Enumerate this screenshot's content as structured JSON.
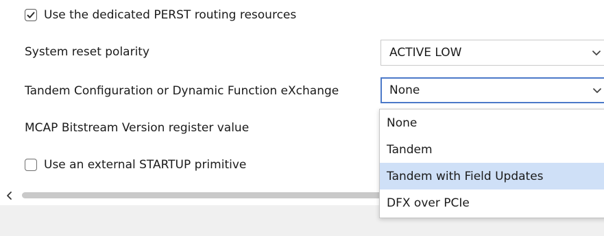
{
  "options": {
    "use_perst_label": "Use the dedicated PERST routing resources",
    "use_perst_checked": true,
    "system_reset_label": "System reset polarity",
    "system_reset_value": "ACTIVE LOW",
    "tandem_label": "Tandem Configuration or Dynamic Function eXchange",
    "tandem_value": "None",
    "mcap_label": "MCAP Bitstream Version register value",
    "startup_label": "Use an external STARTUP primitive",
    "startup_checked": false
  },
  "tandem_dropdown": {
    "items": [
      {
        "label": "None"
      },
      {
        "label": "Tandem"
      },
      {
        "label": "Tandem with Field Updates",
        "highlighted": true
      },
      {
        "label": "DFX over PCIe"
      }
    ]
  },
  "colors": {
    "focus_border": "#4a78c8",
    "highlight": "#cfe0f7",
    "footer_bg": "#f0f0f0"
  },
  "icons": {
    "checkbox_checked": "checkmark-icon",
    "select_arrow": "chevron-down-icon",
    "scroll_left": "chevron-left-icon"
  }
}
